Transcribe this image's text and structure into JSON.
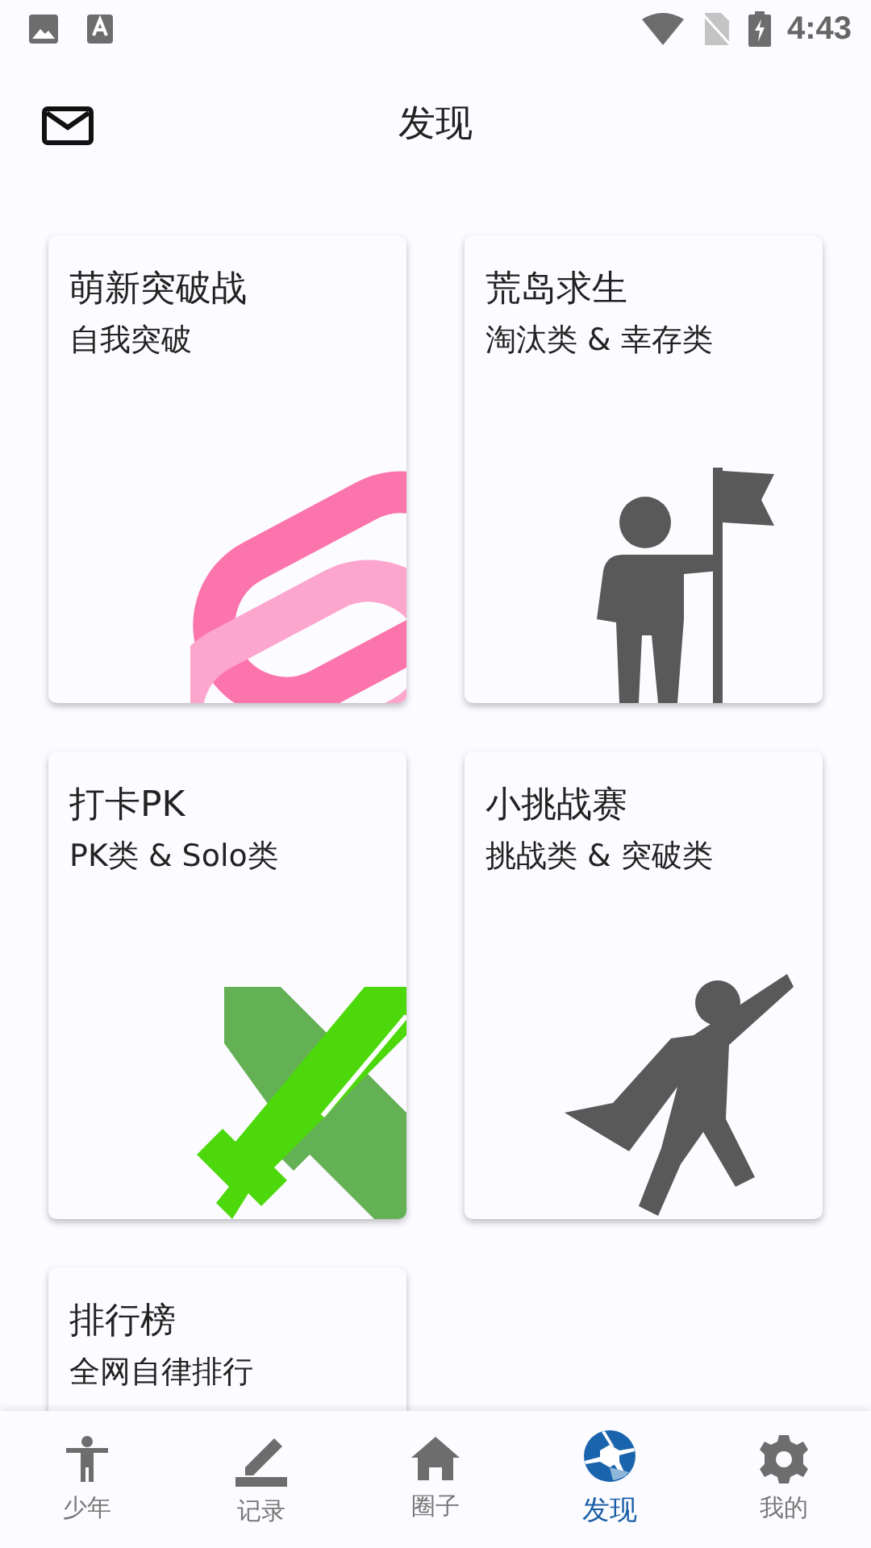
{
  "status_bar": {
    "time": "4:43"
  },
  "header": {
    "title": "发现"
  },
  "cards": [
    {
      "title": "萌新突破战",
      "subtitle": "自我突破"
    },
    {
      "title": "荒岛求生",
      "subtitle": "淘汰类 & 幸存类"
    },
    {
      "title": "打卡PK",
      "subtitle": "PK类 & Solo类"
    },
    {
      "title": "小挑战赛",
      "subtitle": "挑战类 & 突破类"
    },
    {
      "title": "排行榜",
      "subtitle": "全网自律排行"
    }
  ],
  "bottom_nav": [
    {
      "label": "少年",
      "selected": false
    },
    {
      "label": "记录",
      "selected": false
    },
    {
      "label": "圈子",
      "selected": false
    },
    {
      "label": "发现",
      "selected": true
    },
    {
      "label": "我的",
      "selected": false
    }
  ]
}
